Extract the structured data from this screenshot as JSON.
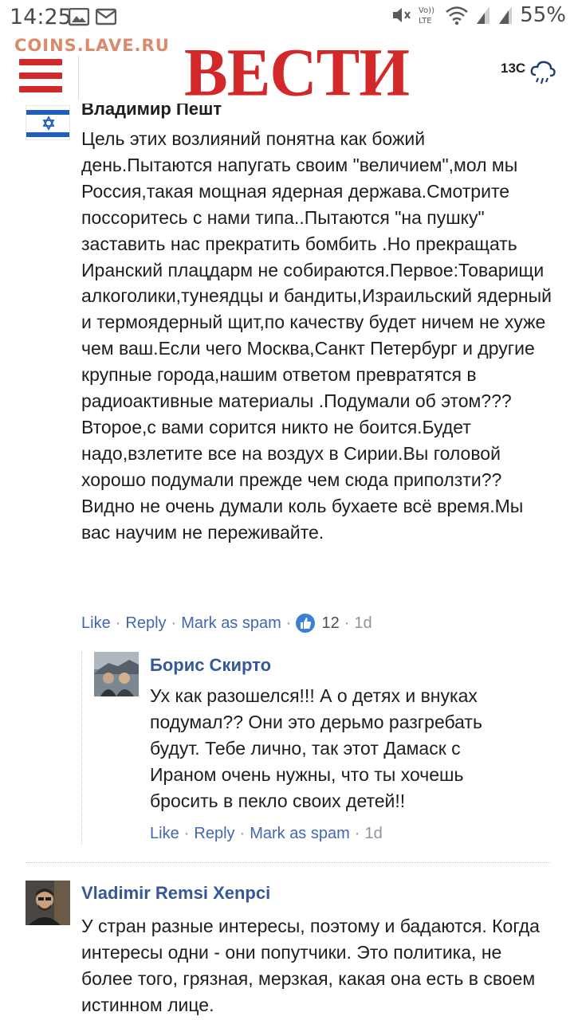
{
  "status_bar": {
    "time": "14:25",
    "battery": "55%",
    "network_label": "VoLTE",
    "icons": [
      "image-icon",
      "mail-icon",
      "mute-icon",
      "volte-icon",
      "wifi-icon",
      "signal-icon",
      "signal-icon",
      "battery-icon"
    ]
  },
  "watermark": "COINS.LAVE.RU",
  "header": {
    "logo": "ВЕСТИ",
    "weather_temp": "13C",
    "weather_icon": "rain-cloud-icon"
  },
  "comments": [
    {
      "author": "Владимир Пешт",
      "text": "Цель этих возлияний понятна как божий день.Пытаются напугать своим \"величием\",мол мы Россия,такая мощная ядерная держава.Смотрите поссоритесь с нами типа..Пытаются \"на пушку\" заставить нас прекратить бомбить .Но прекращать Иранский плацдарм не собираются.Первое:Товарищи алкоголики,тунеядцы и бандиты,Израильский ядерный и термоядерный щит,по качеству будет ничем не хуже чем ваш.Если чего Москва,Санкт Петербург и другие крупные города,нашим ответом превратятся в радиоактивные материалы .Подумали об этом???Второе,с вами сорится никто не боится.Будет надо,взлетите все на воздух в Сирии.Вы головой хорошо подумали прежде чем сюда приползти??Видно не очень думали коль бухаете всё время.Мы вас научим не переживайте.",
      "actions": {
        "like": "Like",
        "reply": "Reply",
        "spam": "Mark as spam",
        "likes_count": "12",
        "time": "1d"
      }
    },
    {
      "author": "Борис Скирто",
      "text": "Ух как разошелся!!! А о детях и внуках подумал?? Они это дерьмо разгребать будут. Тебе лично, так этот Дамаск с Ираном очень нужны, что ты хочешь бросить в пекло своих детей!!",
      "actions": {
        "like": "Like",
        "reply": "Reply",
        "spam": "Mark as spam",
        "time": "1d"
      }
    },
    {
      "author": "Vladimir Remsi Xenpci",
      "text": "У стран разные интересы, поэтому и бадаются. Когда интересы одни - они попутчики. Это политика, не более того, грязная, мерзкая, какая она есть в своем истинном лице."
    }
  ],
  "colors": {
    "brand_red": "#d3282a",
    "link_blue": "#4267b2",
    "author_blue": "#365899",
    "watermark": "#d88a6b"
  }
}
